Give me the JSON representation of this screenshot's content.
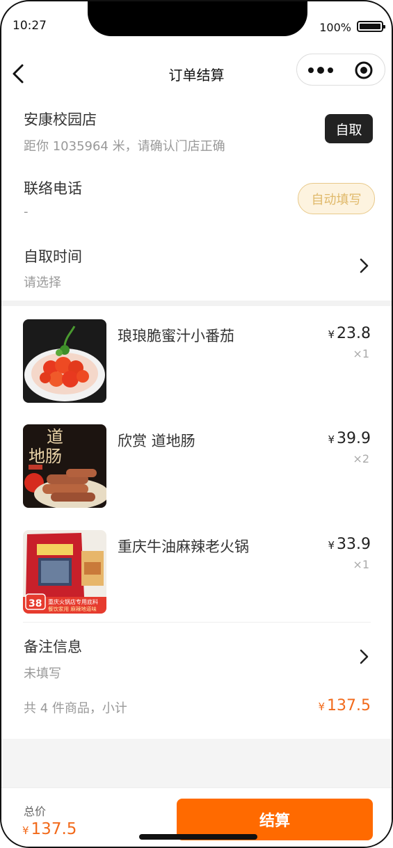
{
  "status_bar": {
    "time": "10:27",
    "battery": "100%"
  },
  "nav": {
    "title": "订单结算"
  },
  "store": {
    "name": "安康校园店",
    "distance": "距你 1035964 米，请确认门店正确",
    "mode_button": "自取"
  },
  "contact": {
    "label": "联络电话",
    "value": "-",
    "autofill_button": "自动填写"
  },
  "pickup_time": {
    "label": "自取时间",
    "value": "请选择"
  },
  "products": [
    {
      "name": "琅琅脆蜜汁小番茄",
      "currency": "¥",
      "price": "23.8",
      "qty": "×1"
    },
    {
      "name": "欣赏 道地肠",
      "currency": "¥",
      "price": "39.9",
      "qty": "×2"
    },
    {
      "name": "重庆牛油麻辣老火锅",
      "currency": "¥",
      "price": "33.9",
      "qty": "×1"
    }
  ],
  "product_images": {
    "sausage_text_1": "道",
    "sausage_text_2": "地肠",
    "hotpot_price": "38",
    "hotpot_brand": "重庆火锅店专用底料",
    "hotpot_slogan": "餐饮家用  麻辣地道味"
  },
  "remarks": {
    "label": "备注信息",
    "value": "未填写"
  },
  "subtotal": {
    "label": "共 4 件商品，小计",
    "currency": "¥",
    "value": "137.5"
  },
  "footer": {
    "total_label": "总价",
    "currency": "¥",
    "total_value": "137.5",
    "checkout_button": "结算"
  },
  "colors": {
    "accent": "#ff6a00",
    "price": "#f26a1b",
    "autofill_bg": "#fdf3df",
    "autofill_text": "#e0b96a"
  }
}
